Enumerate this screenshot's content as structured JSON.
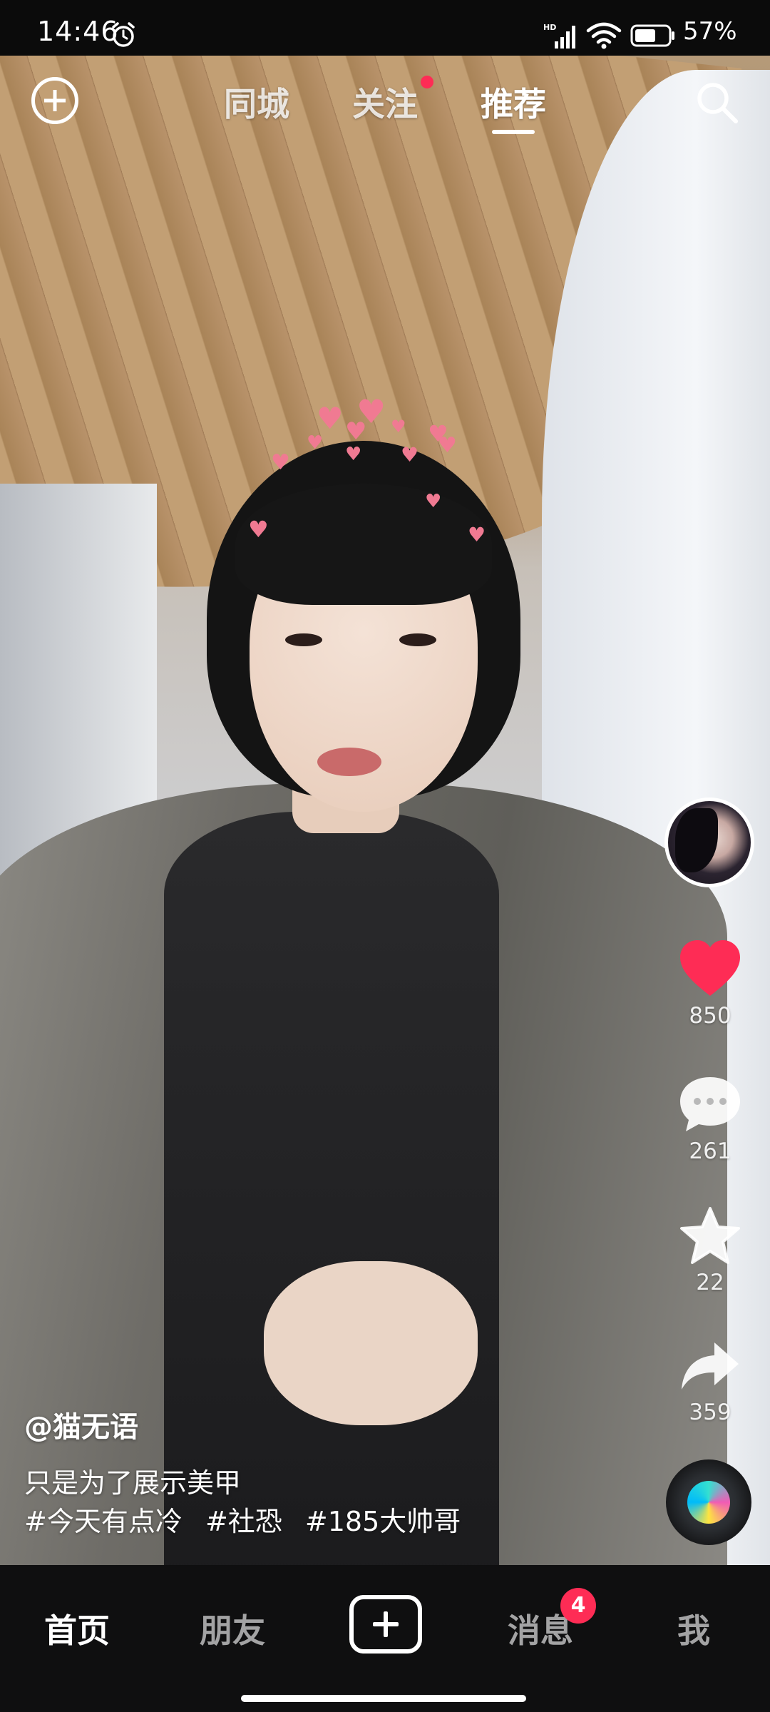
{
  "status_bar": {
    "time": "14:46",
    "battery_percent": "57%",
    "icons": [
      "alarm-icon",
      "signal-hd-icon",
      "wifi-icon",
      "battery-icon"
    ]
  },
  "top_tabs": {
    "items": [
      {
        "label": "同城",
        "active": false
      },
      {
        "label": "关注",
        "active": false,
        "has_dot": true
      },
      {
        "label": "推荐",
        "active": true
      }
    ]
  },
  "video": {
    "author": "@猫无语",
    "description": "只是为了展示美甲",
    "hashtags": [
      "#今天有点冷",
      "#社恐",
      "#185大帅哥"
    ]
  },
  "actions": {
    "likes": "850",
    "comments": "261",
    "favorites": "22",
    "shares": "359"
  },
  "bottom_nav": {
    "items": [
      {
        "label": "首页",
        "active": true
      },
      {
        "label": "朋友",
        "active": false
      },
      {
        "label": "消息",
        "active": false,
        "badge": "4"
      },
      {
        "label": "我",
        "active": false
      }
    ]
  },
  "colors": {
    "accent": "#fe2c55",
    "like": "#fe2c55",
    "nav_background": "#0f0f10"
  }
}
